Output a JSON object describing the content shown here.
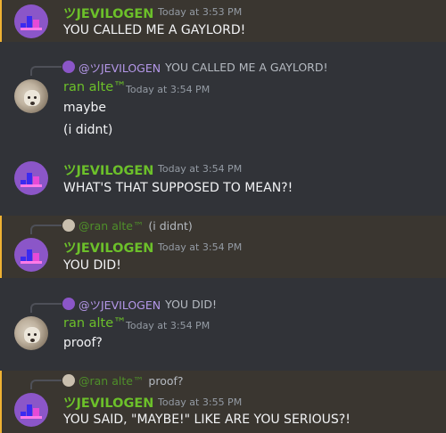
{
  "messages": [
    {
      "author": "ツJEVILOGEN",
      "time": "Today at 3:53 PM",
      "lines": [
        "YOU CALLED ME A GAYLORD!"
      ]
    },
    {
      "reply": {
        "user": "@ツJEVILOGEN",
        "text": "YOU CALLED ME A GAYLORD!"
      },
      "author": "ran alte™",
      "time": "Today at 3:54 PM",
      "lines": [
        "maybe",
        "(i didnt)"
      ]
    },
    {
      "author": "ツJEVILOGEN",
      "time": "Today at 3:54 PM",
      "lines": [
        "WHAT'S THAT SUPPOSED TO MEAN?!"
      ]
    },
    {
      "reply": {
        "user": "@ran alte™",
        "text": "(i didnt)"
      },
      "author": "ツJEVILOGEN",
      "time": "Today at 3:54 PM",
      "lines": [
        "YOU DID!"
      ]
    },
    {
      "reply": {
        "user": "@ツJEVILOGEN",
        "text": "YOU DID!"
      },
      "author": "ran alte™",
      "time": "Today at 3:54 PM",
      "lines": [
        "proof?"
      ]
    },
    {
      "reply": {
        "user": "@ran alte™",
        "text": "proof?"
      },
      "author": "ツJEVILOGEN",
      "time": "Today at 3:55 PM",
      "lines": [
        "YOU SAID, \"MAYBE!\" LIKE ARE YOU SERIOUS?!"
      ]
    }
  ],
  "colors": {
    "background": "#313338",
    "mention_highlight": "#3a3630",
    "mention_bar": "#f0b232",
    "username_green": "#6cc02a",
    "avatar_purple": "#8b56c8"
  }
}
